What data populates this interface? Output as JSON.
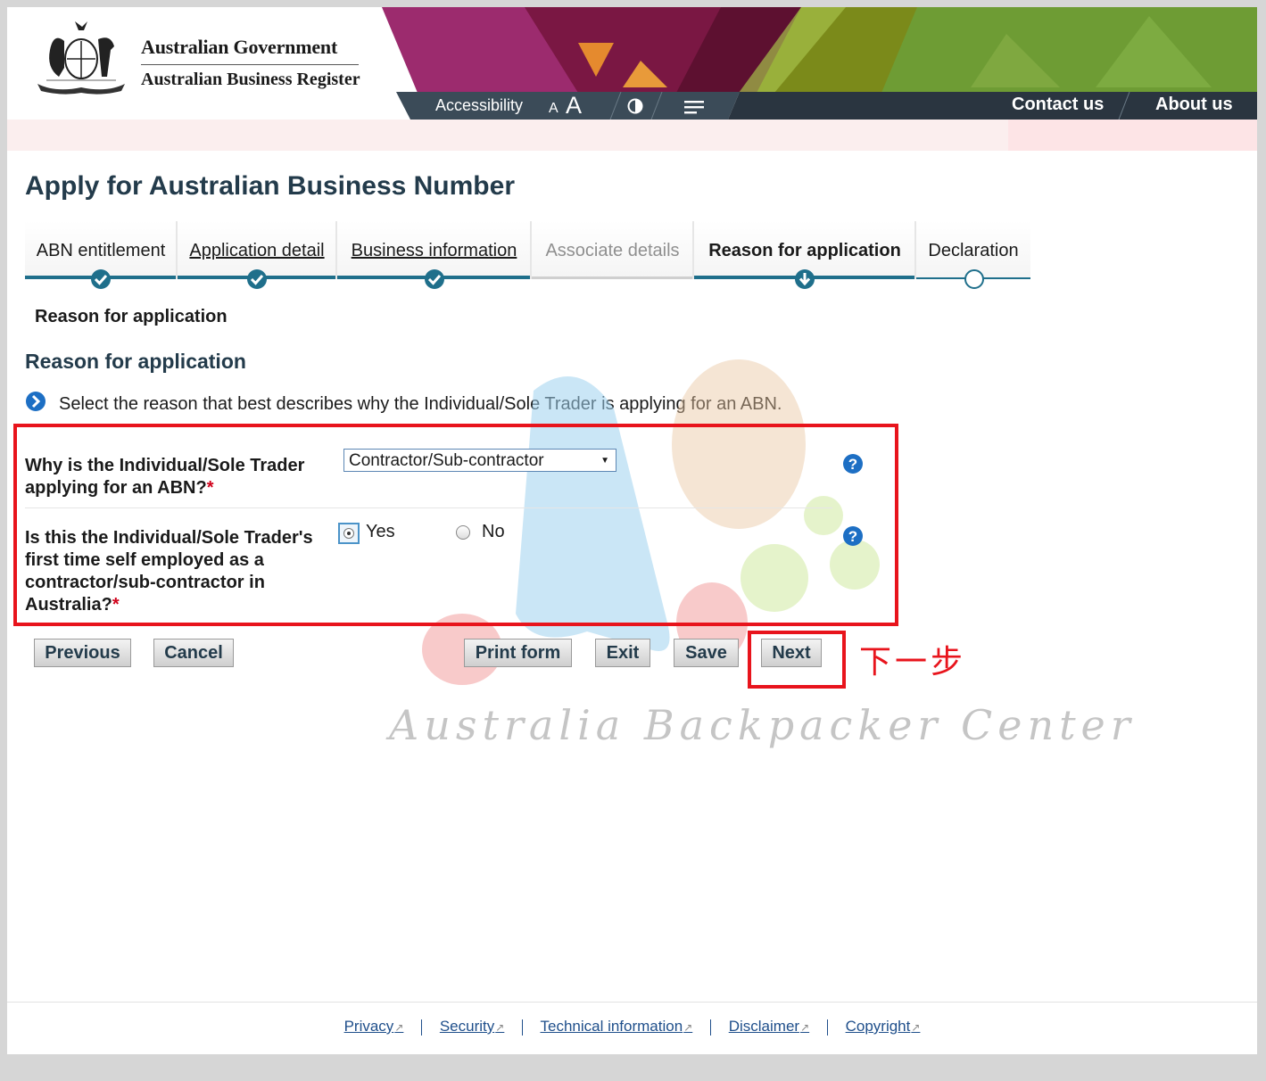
{
  "header": {
    "gov_title": "Australian Government",
    "gov_subtitle": "Australian Business Register",
    "accessibility_label": "Accessibility",
    "font_small": "A",
    "font_large": "A",
    "contact_label": "Contact us",
    "about_label": "About us"
  },
  "page_title": "Apply for Australian Business Number",
  "steps": [
    {
      "label": "ABN entitlement",
      "state": "complete"
    },
    {
      "label": "Application detail",
      "state": "complete"
    },
    {
      "label": "Business information",
      "state": "complete"
    },
    {
      "label": "Associate details",
      "state": "disabled"
    },
    {
      "label": "Reason for application",
      "state": "current"
    },
    {
      "label": "Declaration",
      "state": "pending"
    }
  ],
  "sub_heading": "Reason for application",
  "section_heading": "Reason for application",
  "instruction": "Select the reason that best describes why the Individual/Sole Trader is applying for an ABN.",
  "questions": {
    "q1": {
      "line1": "Why is the Individual/Sole Trader",
      "line2": "applying for an ABN?",
      "required_mark": "*",
      "selected": "Contractor/Sub-contractor",
      "arrow": "▼"
    },
    "q2": {
      "line1": "Is this the Individual/Sole Trader's",
      "line2": "first time self employed as a",
      "line3": "contractor/sub-contractor in",
      "line4": "Australia?",
      "required_mark": "*",
      "option_yes": "Yes",
      "option_no": "No",
      "selected": "Yes"
    }
  },
  "buttons": {
    "previous": "Previous",
    "cancel": "Cancel",
    "print": "Print form",
    "exit": "Exit",
    "save": "Save",
    "next": "Next"
  },
  "annotation": "下一步",
  "watermark_text": "Australia Backpacker Center",
  "footer": {
    "privacy": "Privacy",
    "security": "Security",
    "technical": "Technical information",
    "disclaimer": "Disclaimer",
    "copyright": "Copyright",
    "external_icon": "external-link-icon"
  },
  "colors": {
    "dark_teal": "#1f6f8b",
    "heading": "#233b4b",
    "highlight_red": "#e8141c",
    "link_blue": "#1f4f8b"
  }
}
